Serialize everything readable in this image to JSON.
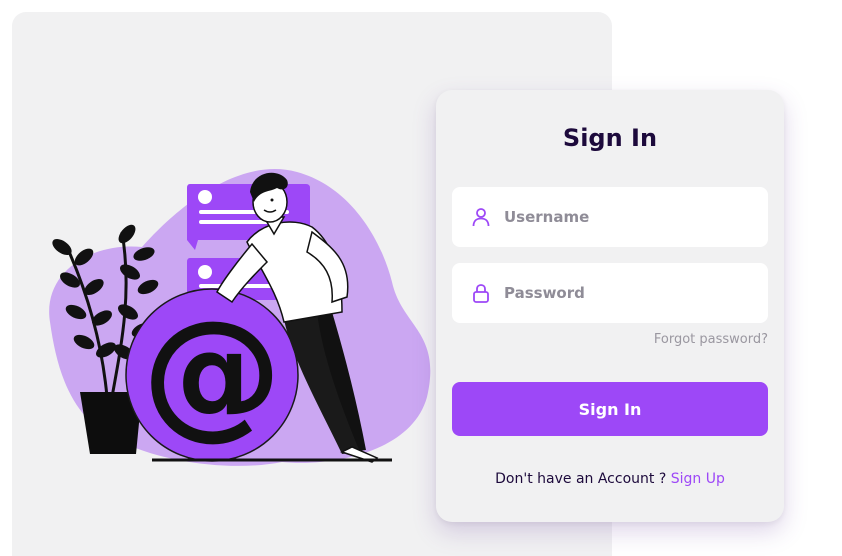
{
  "colors": {
    "accent": "#9d48f7",
    "title": "#1d0a3c",
    "panel_bg": "#f1f1f2",
    "blob": "#cba7f2"
  },
  "illustration": {
    "icon": "email-at-icon"
  },
  "login": {
    "title": "Sign In",
    "username": {
      "value": "",
      "placeholder": "Username",
      "icon": "user-icon"
    },
    "password": {
      "value": "",
      "placeholder": "Password",
      "icon": "lock-icon"
    },
    "forgot_label": "Forgot password?",
    "submit_label": "Sign In",
    "signup_prompt": "Don't have an Account ?",
    "signup_link": "Sign Up"
  }
}
